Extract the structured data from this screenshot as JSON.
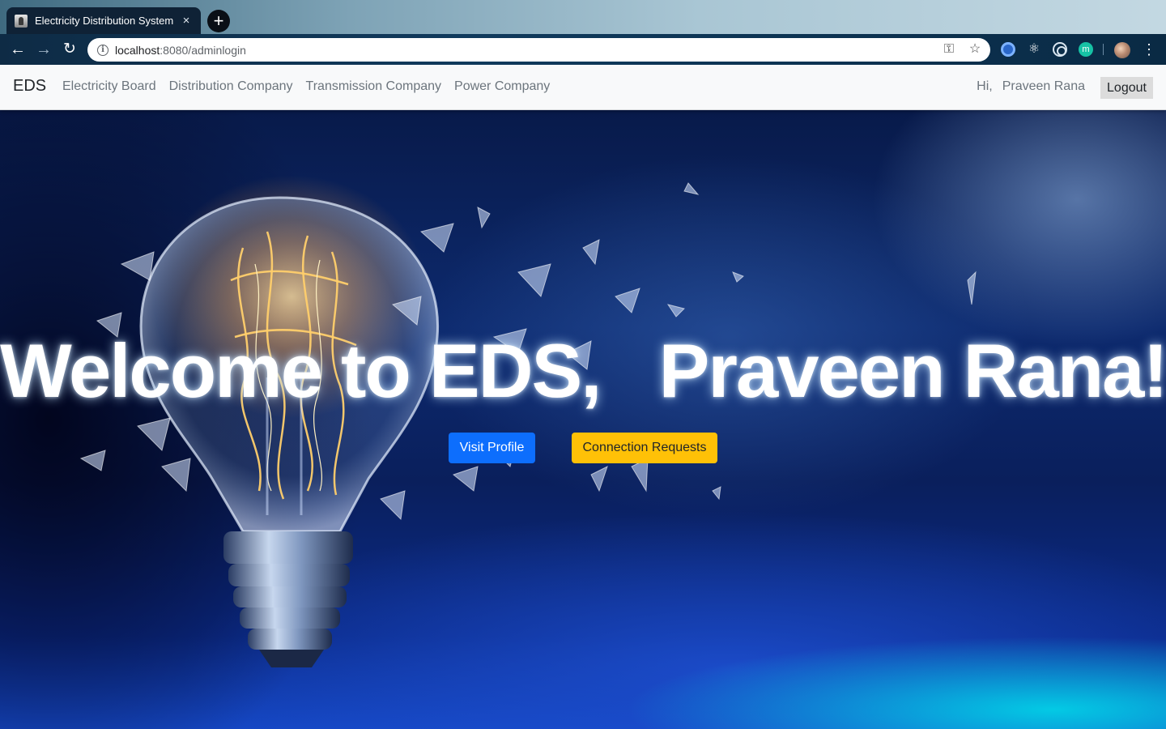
{
  "browser": {
    "tab_title": "Electricity Distribution System",
    "tab_close": "×",
    "new_tab": "+",
    "url_host": "localhost",
    "url_rest": ":8080/adminlogin",
    "icons": [
      "back-icon",
      "forward-icon",
      "reload-icon",
      "info-icon",
      "key-icon",
      "star-icon",
      "menu-icon"
    ]
  },
  "navbar": {
    "brand": "EDS",
    "links": [
      "Electricity Board",
      "Distribution Company",
      "Transmission Company",
      "Power Company"
    ],
    "greeting_prefix": "Hi,",
    "user_name": "Praveen Rana",
    "logout_label": "Logout"
  },
  "hero": {
    "title": "Welcome to EDS,   Praveen Rana!",
    "visit_profile_label": "Visit Profile",
    "connection_requests_label": "Connection Requests"
  },
  "colors": {
    "primary": "#0d6efd",
    "warning": "#ffc107",
    "navbar_bg": "#f8f9fa"
  }
}
